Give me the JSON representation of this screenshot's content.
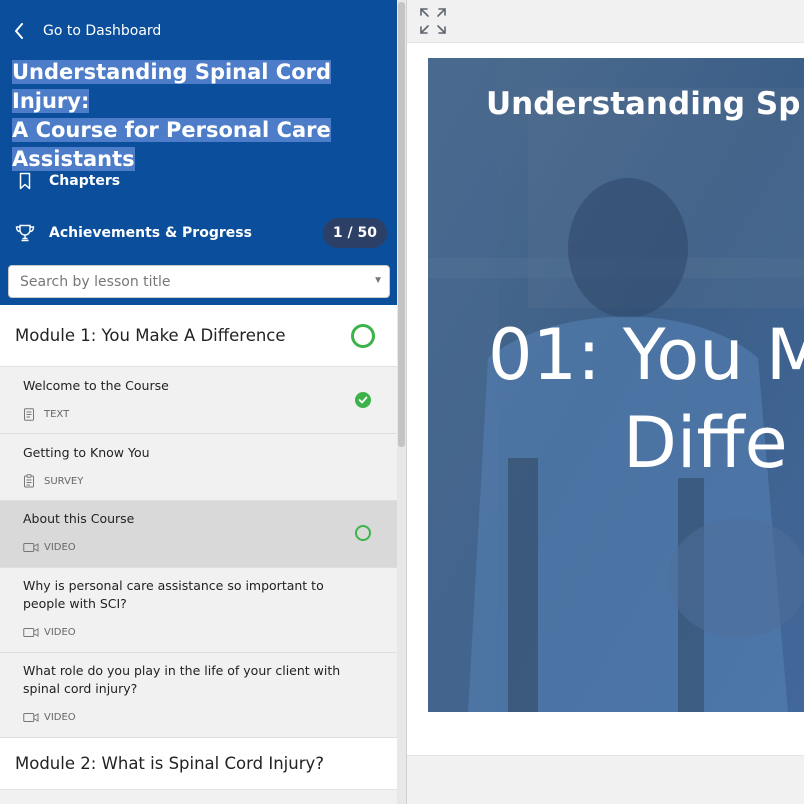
{
  "sidebar": {
    "back_label": "Go to Dashboard",
    "course_title_lines": [
      "Understanding Spinal Cord Injury:",
      "A Course for Personal Care",
      "Assistants"
    ],
    "nav": {
      "chapters_label": "Chapters",
      "achievements_label": "Achievements & Progress",
      "progress_badge": "1 / 50"
    },
    "search": {
      "placeholder": "Search by lesson title"
    },
    "modules": [
      {
        "title": "Module 1: You Make A Difference",
        "lessons": [
          {
            "title": "Welcome to the Course",
            "type": "TEXT",
            "icon": "text-doc-icon",
            "status": "completed"
          },
          {
            "title": "Getting to Know You",
            "type": "SURVEY",
            "icon": "survey-clipboard-icon",
            "status": "none"
          },
          {
            "title": "About this Course",
            "type": "VIDEO",
            "icon": "video-camera-icon",
            "status": "in-progress",
            "active": true
          },
          {
            "title": "Why is personal care assistance so important to people with SCI?",
            "type": "VIDEO",
            "icon": "video-camera-icon",
            "status": "none"
          },
          {
            "title": "What role do you play in the life of your client with spinal cord injury?",
            "type": "VIDEO",
            "icon": "video-camera-icon",
            "status": "none"
          }
        ]
      },
      {
        "title": "Module 2: What is Spinal Cord Injury?"
      }
    ]
  },
  "main": {
    "video": {
      "title": "Understanding Sp",
      "big_line1": "01: You M",
      "big_line2": "Diffe"
    }
  },
  "colors": {
    "header_blue": "#0b4f9c",
    "title_highlight": "#4d7cc8",
    "badge_bg": "#2c3f66",
    "success_green": "#3cb34a"
  }
}
